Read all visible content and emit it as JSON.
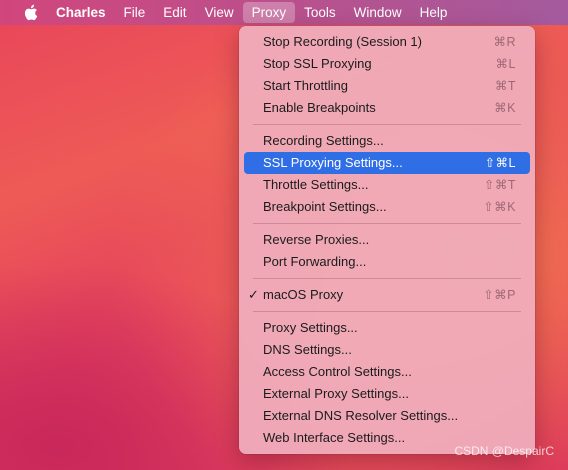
{
  "menubar": {
    "apple_icon": "apple-logo-icon",
    "app": "Charles",
    "items": [
      "File",
      "Edit",
      "View",
      "Proxy",
      "Tools",
      "Window",
      "Help"
    ],
    "active": "Proxy"
  },
  "menu": {
    "groups": [
      [
        {
          "label": "Stop Recording (Session 1)",
          "shortcut": "⌘R"
        },
        {
          "label": "Stop SSL Proxying",
          "shortcut": "⌘L"
        },
        {
          "label": "Start Throttling",
          "shortcut": "⌘T"
        },
        {
          "label": "Enable Breakpoints",
          "shortcut": "⌘K"
        }
      ],
      [
        {
          "label": "Recording Settings...",
          "shortcut": ""
        },
        {
          "label": "SSL Proxying Settings...",
          "shortcut": "⇧⌘L",
          "highlighted": true
        },
        {
          "label": "Throttle Settings...",
          "shortcut": "⇧⌘T"
        },
        {
          "label": "Breakpoint Settings...",
          "shortcut": "⇧⌘K"
        }
      ],
      [
        {
          "label": "Reverse Proxies...",
          "shortcut": ""
        },
        {
          "label": "Port Forwarding...",
          "shortcut": ""
        }
      ],
      [
        {
          "label": "macOS Proxy",
          "shortcut": "⇧⌘P",
          "checked": true,
          "check_mark": "✓"
        }
      ],
      [
        {
          "label": "Proxy Settings...",
          "shortcut": ""
        },
        {
          "label": "DNS Settings...",
          "shortcut": ""
        },
        {
          "label": "Access Control Settings...",
          "shortcut": ""
        },
        {
          "label": "External Proxy Settings...",
          "shortcut": ""
        },
        {
          "label": "External DNS Resolver Settings...",
          "shortcut": ""
        },
        {
          "label": "Web Interface Settings...",
          "shortcut": ""
        }
      ]
    ]
  },
  "watermark": "CSDN @DespairC",
  "colors": {
    "highlight": "#2f6ee5"
  }
}
